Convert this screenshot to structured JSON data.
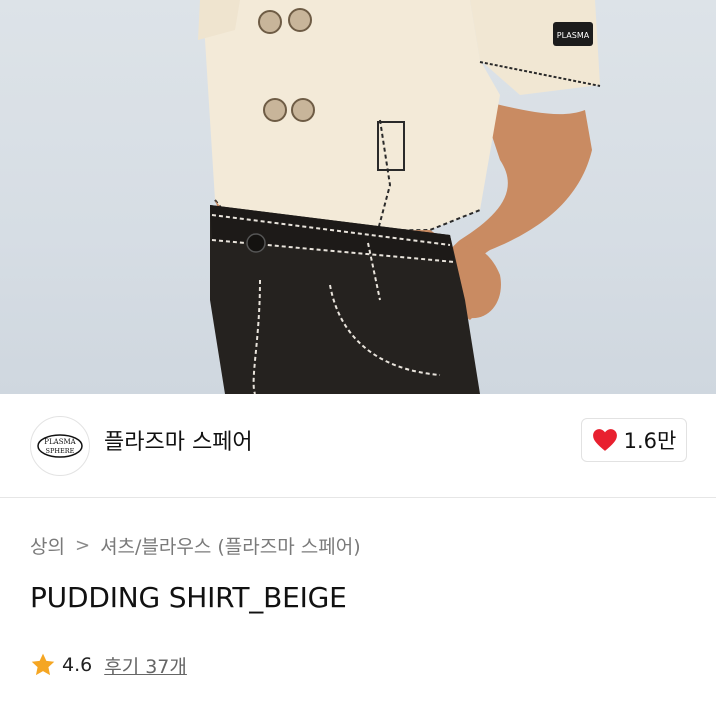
{
  "brand": {
    "name": "플라즈마 스페어",
    "logo_text_top": "PLASMA",
    "logo_text_bottom": "SPHERE"
  },
  "likes": {
    "count": "1.6만",
    "icon": "heart-icon",
    "color": "#e8202f"
  },
  "breadcrumb": {
    "items": [
      "상의",
      "셔츠/블라우스 (플라즈마 스페어)"
    ],
    "separator": ">"
  },
  "product": {
    "title": "PUDDING SHIRT_BEIGE"
  },
  "rating": {
    "score": "4.6",
    "reviews_label": "후기 37개",
    "star_color": "#f5a623"
  },
  "photo": {
    "sleeve_tag_text": "PLASMA"
  }
}
